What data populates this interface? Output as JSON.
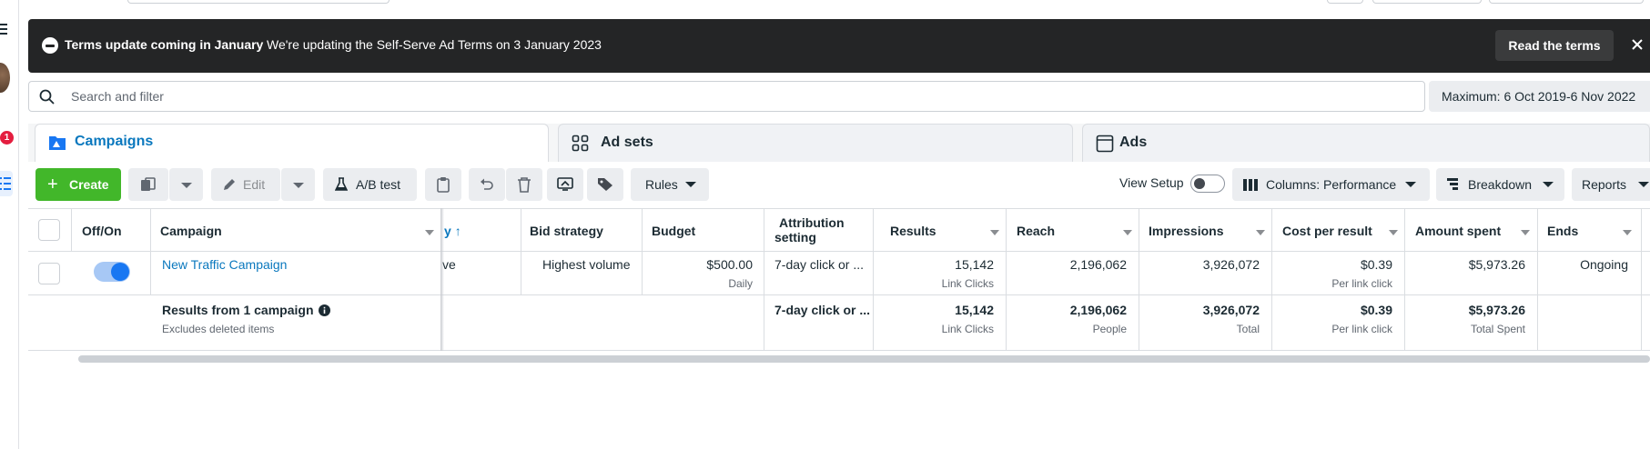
{
  "left_rail": {
    "notification_count": "1"
  },
  "banner": {
    "title": "Terms update coming in January",
    "message": "We're updating the Self-Serve Ad Terms on 3 January 2023",
    "button_label": "Read the terms",
    "icon": "minus-circle-icon"
  },
  "search": {
    "placeholder": "Search and filter",
    "value": ""
  },
  "date_range": {
    "label": "Maximum: 6 Oct 2019-6 Nov 2022"
  },
  "tabs": [
    {
      "label": "Campaigns",
      "icon": "folder-icon",
      "active": true
    },
    {
      "label": "Ad sets",
      "icon": "grid-icon",
      "active": false
    },
    {
      "label": "Ads",
      "icon": "ad-icon",
      "active": false
    }
  ],
  "toolbar": {
    "create_label": "Create",
    "edit_label": "Edit",
    "ab_test_label": "A/B test",
    "rules_label": "Rules",
    "view_setup_label": "View Setup",
    "view_setup_on": false,
    "columns_label": "Columns: Performance",
    "breakdown_label": "Breakdown",
    "reports_label": "Reports"
  },
  "table": {
    "headers": {
      "off_on": "Off/On",
      "campaign": "Campaign",
      "delivery_fragment": "y",
      "bid_strategy": "Bid strategy",
      "budget": "Budget",
      "attribution_line1": "Attribution",
      "attribution_line2": "setting",
      "results": "Results",
      "reach": "Reach",
      "impressions": "Impressions",
      "cost_per_result": "Cost per result",
      "amount_spent": "Amount spent",
      "ends": "Ends"
    },
    "row": {
      "toggle_on": true,
      "campaign_name": "New Traffic Campaign",
      "delivery_fragment": "ve",
      "bid_strategy": "Highest volume",
      "budget": "$500.00",
      "budget_sub": "Daily",
      "attribution": "7-day click or ...",
      "results": "15,142",
      "results_sub": "Link Clicks",
      "reach": "2,196,062",
      "impressions": "3,926,072",
      "cost_per_result": "$0.39",
      "cost_per_result_sub": "Per link click",
      "amount_spent": "$5,973.26",
      "ends": "Ongoing"
    },
    "summary": {
      "title": "Results from 1 campaign",
      "subtitle": "Excludes deleted items",
      "attribution": "7-day click or ...",
      "results": "15,142",
      "results_sub": "Link Clicks",
      "reach": "2,196,062",
      "reach_sub": "People",
      "impressions": "3,926,072",
      "impressions_sub": "Total",
      "cost_per_result": "$0.39",
      "cost_per_result_sub": "Per link click",
      "amount_spent": "$5,973.26",
      "amount_spent_sub": "Total Spent"
    }
  },
  "colors": {
    "accent_blue": "#0a78be",
    "create_green": "#42b72a",
    "banner_bg": "#242526",
    "toggle_blue": "#1877f2"
  }
}
